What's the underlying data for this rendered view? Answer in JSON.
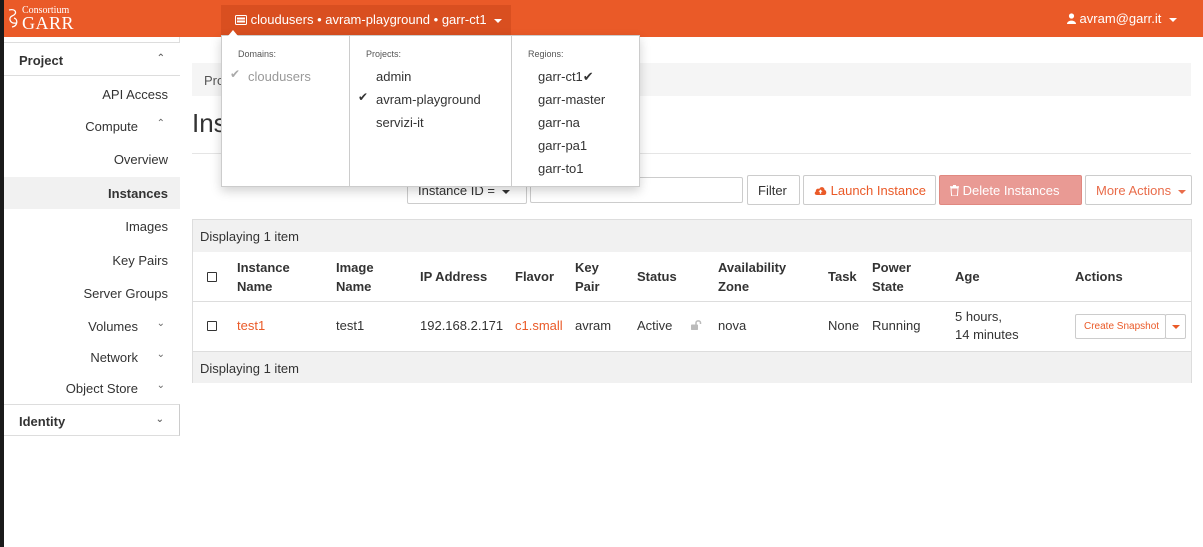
{
  "header": {
    "logo_small": "Consortium",
    "logo_big": "GARR",
    "context_label": "cloudusers • avram-playground • garr-ct1",
    "user_label": "avram@garr.it"
  },
  "sidebar": {
    "project": "Project",
    "api_access": "API Access",
    "compute": "Compute",
    "overview": "Overview",
    "instances": "Instances",
    "images": "Images",
    "key_pairs": "Key Pairs",
    "server_groups": "Server Groups",
    "volumes": "Volumes",
    "network": "Network",
    "object_store": "Object Store",
    "identity": "Identity"
  },
  "main": {
    "breadcrumb": "Pro",
    "title": "Ins",
    "filter_select": "Instance ID =",
    "filter_button": "Filter",
    "launch_button": "Launch Instance",
    "delete_button": "Delete Instances",
    "more_actions": "More Actions"
  },
  "table": {
    "caption": "Displaying 1 item",
    "headers": {
      "name_1": "Instance",
      "name_2": "Name",
      "image_1": "Image",
      "image_2": "Name",
      "ip": "IP Address",
      "flavor": "Flavor",
      "key_1": "Key",
      "key_2": "Pair",
      "status": "Status",
      "az_1": "Availability",
      "az_2": "Zone",
      "task": "Task",
      "power_1": "Power",
      "power_2": "State",
      "age": "Age",
      "actions": "Actions"
    },
    "row": {
      "name": "test1",
      "image": "test1",
      "ip": "192.168.2.171",
      "flavor": "c1.small",
      "key_pair": "avram",
      "status": "Active",
      "az": "nova",
      "task": "None",
      "power": "Running",
      "age_1": "5 hours,",
      "age_2": "14 minutes",
      "action": "Create Snapshot"
    }
  },
  "context_dropdown": {
    "domains_head": "Domains:",
    "domains": [
      "cloudusers"
    ],
    "projects_head": "Projects:",
    "projects": [
      "admin",
      "avram-playground",
      "servizi-it"
    ],
    "regions_head": "Regions:",
    "regions": [
      "garr-ct1",
      "garr-master",
      "garr-na",
      "garr-pa1",
      "garr-to1"
    ]
  },
  "colors": {
    "brand": "#ea5a28",
    "delete": "#e99a94"
  }
}
